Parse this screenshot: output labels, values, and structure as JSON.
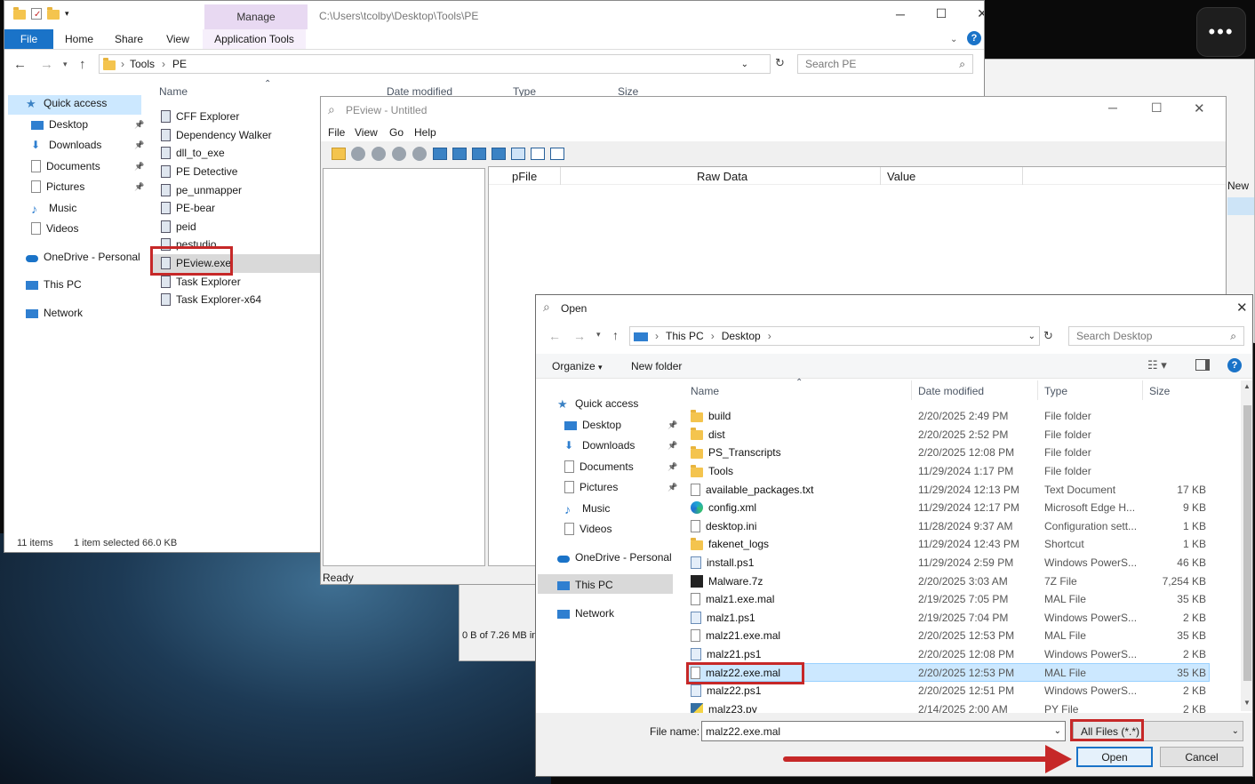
{
  "explorer": {
    "path_title": "C:\\Users\\tcolby\\Desktop\\Tools\\PE",
    "ribbon_manage": "Manage",
    "ribbon_tabs": [
      "File",
      "Home",
      "Share",
      "View",
      "Application Tools"
    ],
    "breadcrumb": [
      "Tools",
      "PE"
    ],
    "search_placeholder": "Search PE",
    "columns": [
      "Name",
      "Date modified",
      "Type",
      "Size"
    ],
    "nav": [
      {
        "label": "Quick access",
        "icon": "star-icon"
      },
      {
        "label": "Desktop",
        "icon": "desktop-icon"
      },
      {
        "label": "Downloads",
        "icon": "download-icon"
      },
      {
        "label": "Documents",
        "icon": "document-icon"
      },
      {
        "label": "Pictures",
        "icon": "pictures-icon"
      },
      {
        "label": "Music",
        "icon": "music-icon"
      },
      {
        "label": "Videos",
        "icon": "video-icon"
      },
      {
        "label": "OneDrive - Personal",
        "icon": "cloud-icon"
      },
      {
        "label": "This PC",
        "icon": "computer-icon"
      },
      {
        "label": "Network",
        "icon": "network-icon"
      }
    ],
    "files": [
      "CFF Explorer",
      "Dependency Walker",
      "dll_to_exe",
      "PE Detective",
      "pe_unmapper",
      "PE-bear",
      "peid",
      "pestudio",
      "PEview.exe",
      "Task Explorer",
      "Task Explorer-x64"
    ],
    "status_items": "11 items",
    "status_selected": "1 item selected  66.0 KB"
  },
  "peview": {
    "title": "PEview - Untitled",
    "menu": [
      "File",
      "View",
      "Go",
      "Help"
    ],
    "columns": [
      "pFile",
      "Raw Data",
      "Value"
    ],
    "status": "Ready"
  },
  "background": {
    "progress_text": "0 B of 7.26 MB in",
    "right_label": "New"
  },
  "open_dialog": {
    "title": "Open",
    "breadcrumb": [
      "This PC",
      "Desktop"
    ],
    "search_placeholder": "Search Desktop",
    "organize": "Organize",
    "new_folder": "New folder",
    "columns": [
      "Name",
      "Date modified",
      "Type",
      "Size"
    ],
    "nav": [
      {
        "label": "Quick access"
      },
      {
        "label": "Desktop"
      },
      {
        "label": "Downloads"
      },
      {
        "label": "Documents"
      },
      {
        "label": "Pictures"
      },
      {
        "label": "Music"
      },
      {
        "label": "Videos"
      },
      {
        "label": "OneDrive - Personal"
      },
      {
        "label": "This PC"
      },
      {
        "label": "Network"
      }
    ],
    "files": [
      {
        "name": "build",
        "date": "2/20/2025 2:49 PM",
        "type": "File folder",
        "size": "",
        "kind": "folder"
      },
      {
        "name": "dist",
        "date": "2/20/2025 2:52 PM",
        "type": "File folder",
        "size": "",
        "kind": "folder"
      },
      {
        "name": "PS_Transcripts",
        "date": "2/20/2025 12:08 PM",
        "type": "File folder",
        "size": "",
        "kind": "folder"
      },
      {
        "name": "Tools",
        "date": "11/29/2024 1:17 PM",
        "type": "File folder",
        "size": "",
        "kind": "folder"
      },
      {
        "name": "available_packages.txt",
        "date": "11/29/2024 12:13 PM",
        "type": "Text Document",
        "size": "17 KB",
        "kind": "doc"
      },
      {
        "name": "config.xml",
        "date": "11/29/2024 12:17 PM",
        "type": "Microsoft Edge H...",
        "size": "9 KB",
        "kind": "edge"
      },
      {
        "name": "desktop.ini",
        "date": "11/28/2024 9:37 AM",
        "type": "Configuration sett...",
        "size": "1 KB",
        "kind": "doc"
      },
      {
        "name": "fakenet_logs",
        "date": "11/29/2024 12:43 PM",
        "type": "Shortcut",
        "size": "1 KB",
        "kind": "folder"
      },
      {
        "name": "install.ps1",
        "date": "11/29/2024 2:59 PM",
        "type": "Windows PowerS...",
        "size": "46 KB",
        "kind": "ps"
      },
      {
        "name": "Malware.7z",
        "date": "2/20/2025 3:03 AM",
        "type": "7Z File",
        "size": "7,254 KB",
        "kind": "7z"
      },
      {
        "name": "malz1.exe.mal",
        "date": "2/19/2025 7:05 PM",
        "type": "MAL File",
        "size": "35 KB",
        "kind": "doc"
      },
      {
        "name": "malz1.ps1",
        "date": "2/19/2025 7:04 PM",
        "type": "Windows PowerS...",
        "size": "2 KB",
        "kind": "ps"
      },
      {
        "name": "malz21.exe.mal",
        "date": "2/20/2025 12:53 PM",
        "type": "MAL File",
        "size": "35 KB",
        "kind": "doc"
      },
      {
        "name": "malz21.ps1",
        "date": "2/20/2025 12:08 PM",
        "type": "Windows PowerS...",
        "size": "2 KB",
        "kind": "ps"
      },
      {
        "name": "malz22.exe.mal",
        "date": "2/20/2025 12:53 PM",
        "type": "MAL File",
        "size": "35 KB",
        "kind": "doc"
      },
      {
        "name": "malz22.ps1",
        "date": "2/20/2025 12:51 PM",
        "type": "Windows PowerS...",
        "size": "2 KB",
        "kind": "ps"
      },
      {
        "name": "malz23.py",
        "date": "2/14/2025 2:00 AM",
        "type": "PY File",
        "size": "2 KB",
        "kind": "py"
      }
    ],
    "file_name_label": "File name:",
    "file_name_value": "malz22.exe.mal",
    "filter_value": "All Files (*.*)",
    "open_button": "Open",
    "cancel_button": "Cancel"
  },
  "colors": {
    "highlight_red": "#c62828",
    "selection_blue": "#cce8ff",
    "accent_blue": "#1a73c8"
  }
}
